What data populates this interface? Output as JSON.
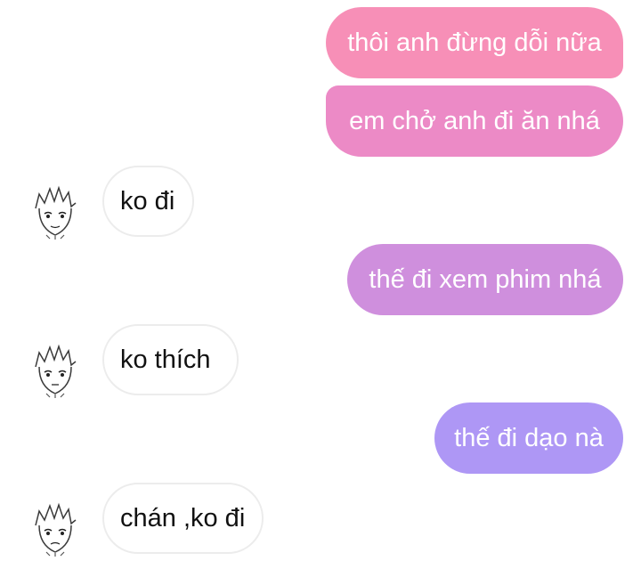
{
  "conversation": {
    "messages": [
      {
        "sender": "me",
        "text": "thôi anh đừng dỗi nữa",
        "color": "#f78fb7"
      },
      {
        "sender": "me",
        "text": "em chở anh đi ăn nhá",
        "color": "#ec8ac6"
      },
      {
        "sender": "other",
        "text": "ko đi"
      },
      {
        "sender": "me",
        "text": "thế đi xem phim nhá",
        "color": "#cf8fdd"
      },
      {
        "sender": "other",
        "text": "ko thích"
      },
      {
        "sender": "me",
        "text": "thế đi dạo nà",
        "color": "#ae97f5"
      },
      {
        "sender": "other",
        "text": "chán ,ko đi"
      }
    ]
  },
  "colors": {
    "background": "#ffffff",
    "incoming_border": "#ececec",
    "incoming_text": "#111111",
    "outgoing_text": "#ffffff"
  },
  "icons": {
    "avatar": "manga-boy-face-icon"
  }
}
